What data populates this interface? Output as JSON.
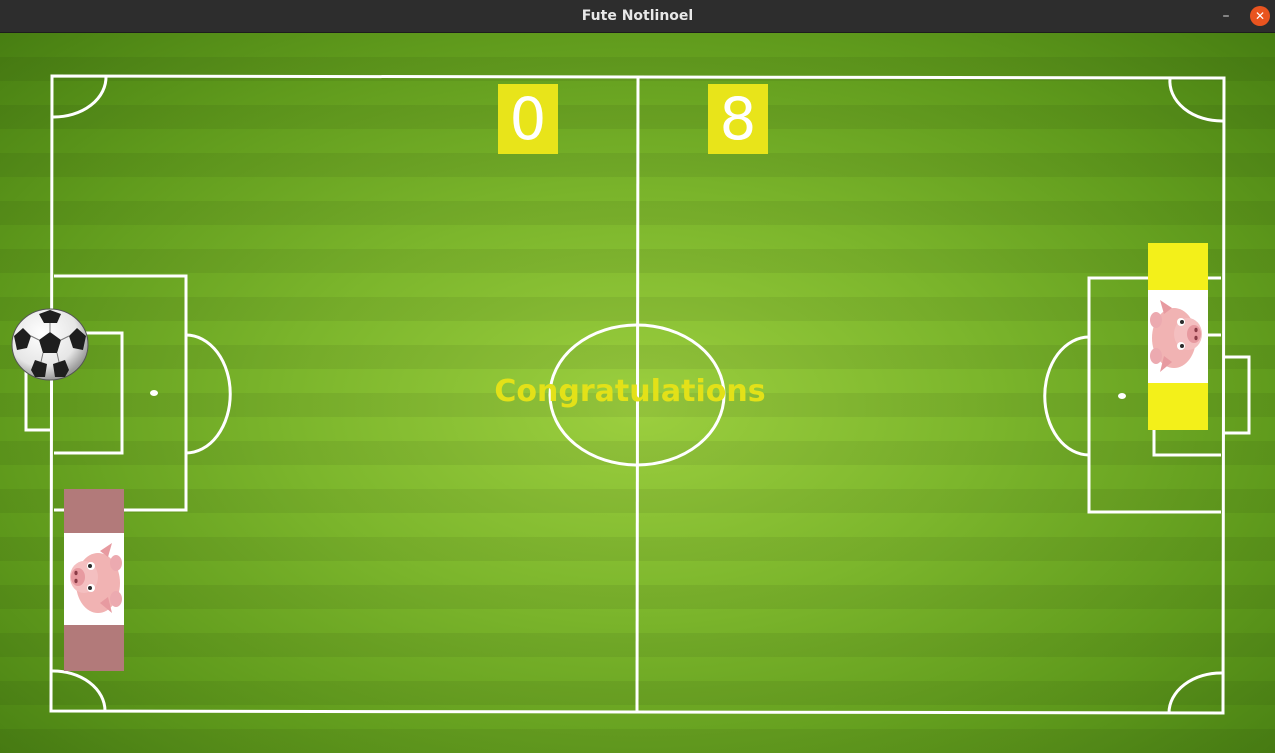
{
  "window": {
    "title": "Fute Notlinoel",
    "minimize_glyph": "–",
    "close_glyph": "✕"
  },
  "scoreboard": {
    "left": "0",
    "right": "8"
  },
  "message": "Congratulations",
  "colors": {
    "score_bg": "#e8e41a",
    "message": "#e3e118",
    "left_paddle": "#b27a7a",
    "right_paddle": "#f3f01a",
    "close_button": "#e9541f",
    "pitch_lines": "#ffffff"
  },
  "icons": {
    "ball": "soccer-ball-icon",
    "paddle_image": "pig-icon"
  }
}
